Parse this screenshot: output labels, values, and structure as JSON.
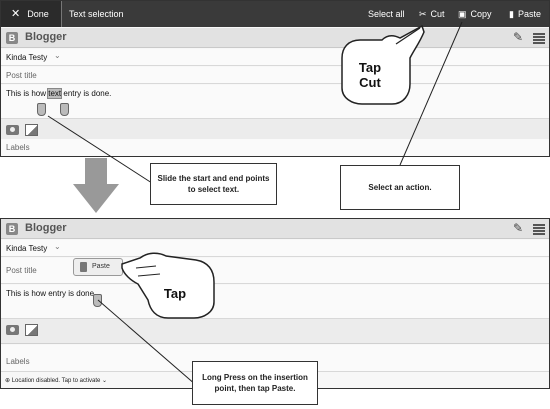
{
  "screen1": {
    "action_bar": {
      "done_label": "Done",
      "title": "Text selection",
      "select_all": "Select all",
      "cut": "Cut",
      "copy": "Copy",
      "paste": "Paste"
    },
    "app_name": "Blogger",
    "blog_name": "Kinda Testy",
    "post_title_placeholder": "Post title",
    "body_before": "This is how ",
    "body_selected": "text",
    "body_after": " entry is done.",
    "labels_placeholder": "Labels",
    "gesture_text": "Tap\nCut"
  },
  "screen2": {
    "app_name": "Blogger",
    "blog_name": "Kinda Testy",
    "post_title_placeholder": "Post title",
    "paste_button": "Paste",
    "body_text": "This is how  entry is done.",
    "labels_placeholder": "Labels",
    "status_text": "Location disabled. Tap to activate",
    "gesture_text": "Tap"
  },
  "callouts": {
    "select_text": "Slide the start and end points to select text.",
    "select_action": "Select an action.",
    "long_press": "Long Press on the insertion point, then tap Paste."
  },
  "icons": [
    "close-icon",
    "scissors-icon",
    "copy-icon",
    "paste-clipboard-icon",
    "blogger-logo-icon",
    "pencil-icon",
    "grid-menu-icon",
    "camera-icon",
    "image-icon",
    "down-arrow-icon",
    "hand-pointer-icon"
  ]
}
